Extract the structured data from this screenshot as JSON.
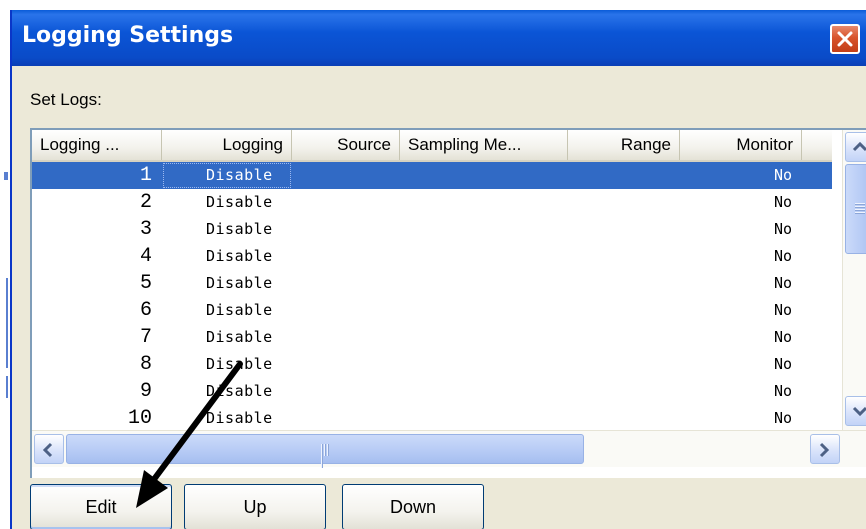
{
  "window": {
    "title": "Logging Settings",
    "close_glyph": "✕"
  },
  "set_logs_label": "Set Logs:",
  "table": {
    "columns": [
      {
        "key": "logging_index",
        "label": "Logging ..."
      },
      {
        "key": "logging",
        "label": "Logging"
      },
      {
        "key": "source",
        "label": "Source"
      },
      {
        "key": "sampling_method",
        "label": "Sampling Me..."
      },
      {
        "key": "range",
        "label": "Range"
      },
      {
        "key": "monitor",
        "label": "Monitor"
      }
    ],
    "rows": [
      {
        "logging_index": "1",
        "logging": "Disable",
        "source": "",
        "sampling_method": "",
        "range": "",
        "monitor": "No",
        "selected": true
      },
      {
        "logging_index": "2",
        "logging": "Disable",
        "source": "",
        "sampling_method": "",
        "range": "",
        "monitor": "No"
      },
      {
        "logging_index": "3",
        "logging": "Disable",
        "source": "",
        "sampling_method": "",
        "range": "",
        "monitor": "No"
      },
      {
        "logging_index": "4",
        "logging": "Disable",
        "source": "",
        "sampling_method": "",
        "range": "",
        "monitor": "No"
      },
      {
        "logging_index": "5",
        "logging": "Disable",
        "source": "",
        "sampling_method": "",
        "range": "",
        "monitor": "No"
      },
      {
        "logging_index": "6",
        "logging": "Disable",
        "source": "",
        "sampling_method": "",
        "range": "",
        "monitor": "No"
      },
      {
        "logging_index": "7",
        "logging": "Disable",
        "source": "",
        "sampling_method": "",
        "range": "",
        "monitor": "No"
      },
      {
        "logging_index": "8",
        "logging": "Disable",
        "source": "",
        "sampling_method": "",
        "range": "",
        "monitor": "No"
      },
      {
        "logging_index": "9",
        "logging": "Disable",
        "source": "",
        "sampling_method": "",
        "range": "",
        "monitor": "No"
      },
      {
        "logging_index": "10",
        "logging": "Disable",
        "source": "",
        "sampling_method": "",
        "range": "",
        "monitor": "No"
      }
    ]
  },
  "buttons": {
    "edit": "Edit",
    "up": "Up",
    "down": "Down"
  },
  "icons": {
    "close": "close-icon",
    "scroll_up": "chevron-up-icon",
    "scroll_down": "chevron-down-icon",
    "scroll_left": "chevron-left-icon",
    "scroll_right": "chevron-right-icon",
    "annotation": "arrow-annotation-icon"
  },
  "colors": {
    "titlebar": "#0b55d6",
    "selection": "#316ac5",
    "dialog_face": "#ece9d8",
    "close_button": "#d8542c"
  }
}
